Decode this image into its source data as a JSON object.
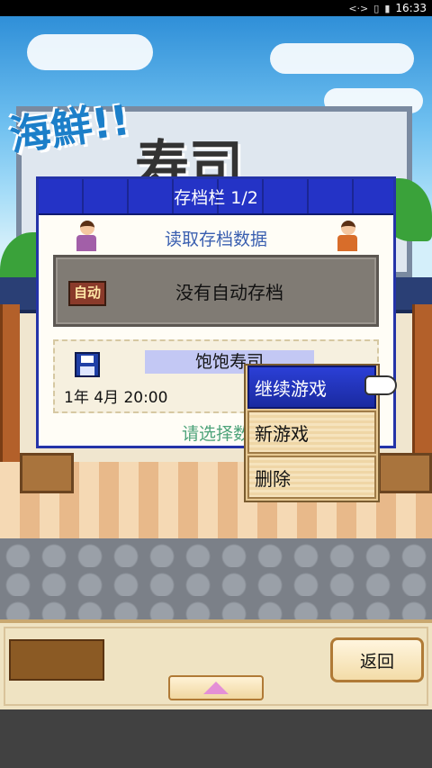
{
  "status_bar": {
    "icons": [
      "code-icon",
      "vibrate-icon",
      "battery-icon"
    ],
    "time": "16:33"
  },
  "scene": {
    "sign_title_top": "海鮮!!",
    "sign_title_main": "寿司"
  },
  "dialog": {
    "title": "存档栏 1/2",
    "subtitle": "读取存档数据",
    "auto_slot": {
      "icon_label": "自动",
      "text": "没有自动存档"
    },
    "slot_1": {
      "name": "饱饱寿司",
      "date": "1年 4月 20:00"
    },
    "hint": "请选择数"
  },
  "context_menu": {
    "items": [
      {
        "label": "继续游戏",
        "selected": true
      },
      {
        "label": "新游戏",
        "selected": false
      },
      {
        "label": "删除",
        "selected": false
      }
    ]
  },
  "bottom_panel": {
    "back_label": "返回"
  },
  "colors": {
    "dialog_header": "#2433c6",
    "menu_selected": "#2b3fd6",
    "auto_slot_bg": "#807b74",
    "hint_text": "#4da37a"
  }
}
